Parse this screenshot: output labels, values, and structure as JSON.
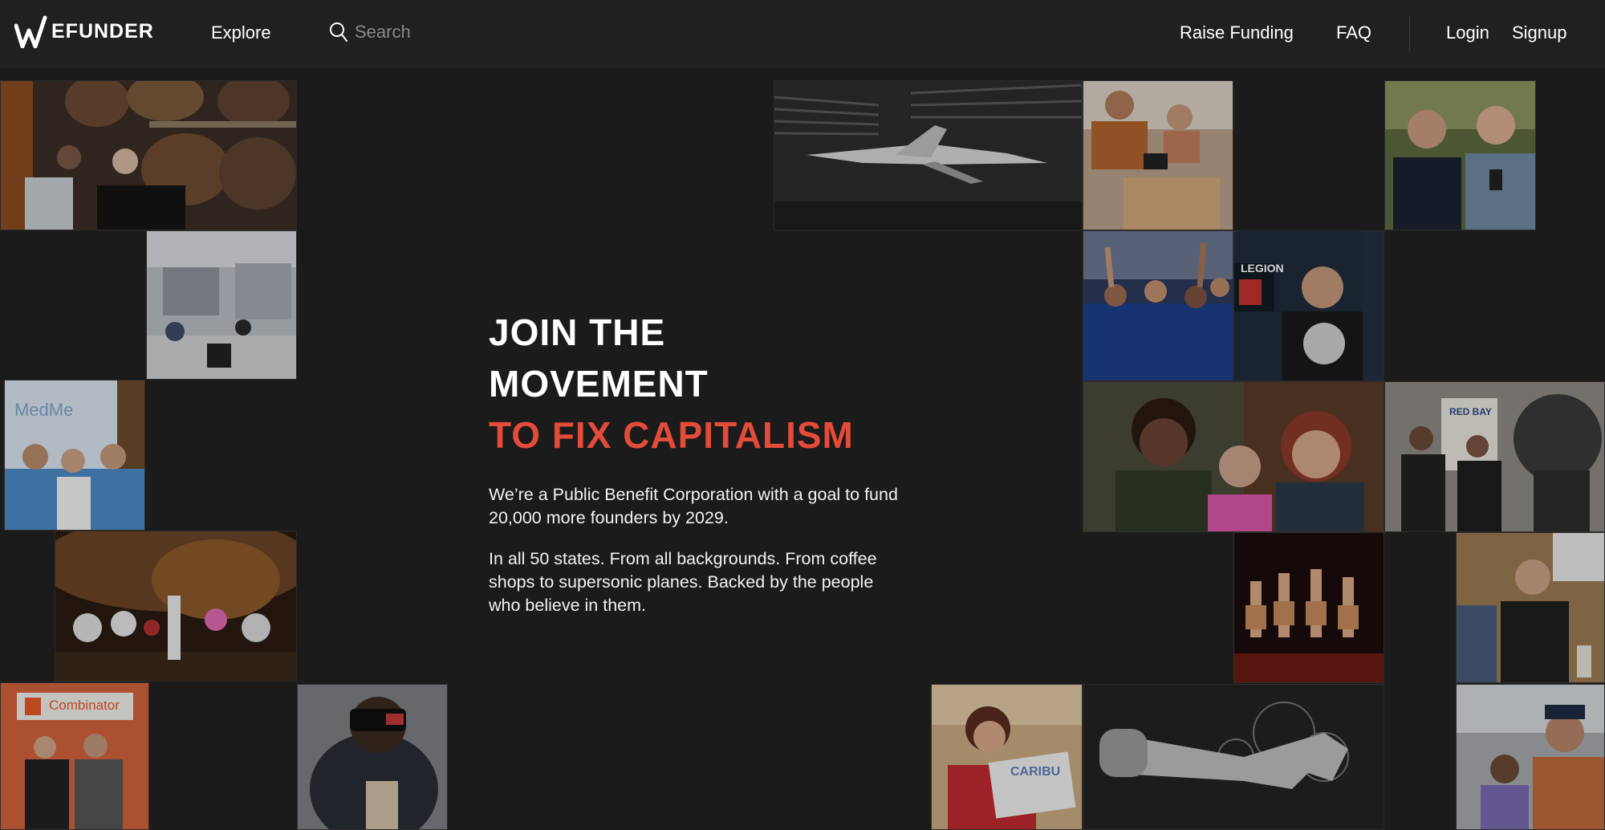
{
  "nav": {
    "logo_text": "EFUNDER",
    "explore": "Explore",
    "search_placeholder": "Search",
    "raise_funding": "Raise Funding",
    "faq": "FAQ",
    "login": "Login",
    "signup": "Signup"
  },
  "hero": {
    "line1": "JOIN THE",
    "line2": "MOVEMENT",
    "accent": "TO FIX CAPITALISM",
    "p1": "We’re a Public Benefit Corporation with a goal to fund 20,000 more founders by 2029.",
    "p2": "In all 50 states. From all backgrounds. From coffee shops to supersonic planes. Backed by the people who believe in them."
  },
  "tiles": {
    "medme": "MedMe",
    "ycombinator": "Combinator",
    "legion": "LEGION",
    "redbay": "RED BAY",
    "caribu": "CARIBU"
  },
  "colors": {
    "background": "#1c1b1b",
    "nav": "#221f1f",
    "accent": "#e34b3a"
  }
}
